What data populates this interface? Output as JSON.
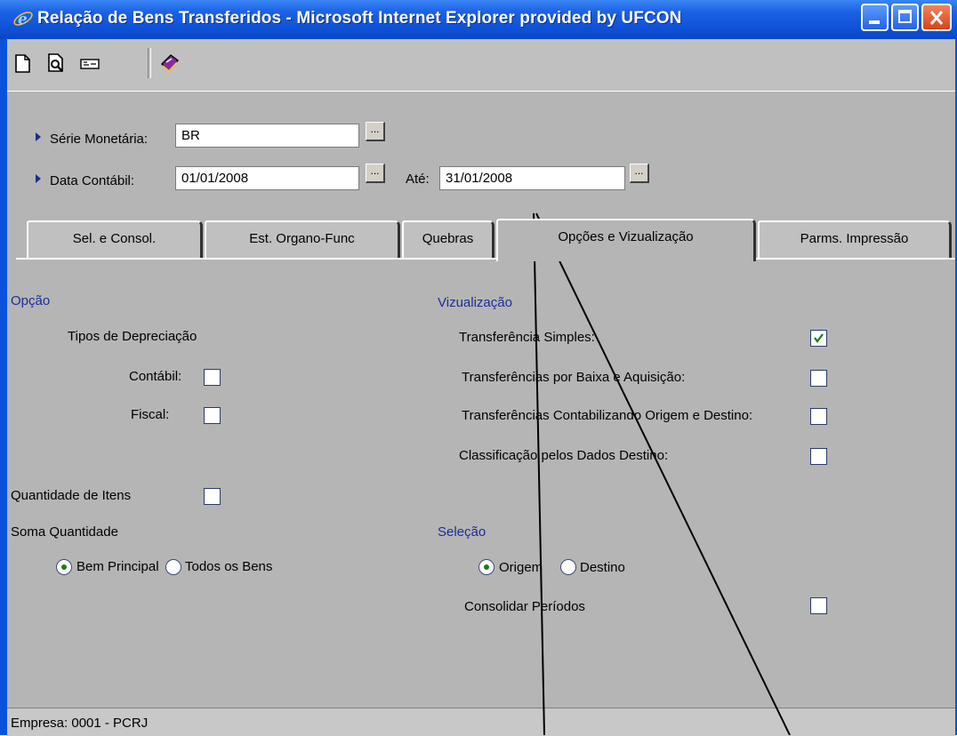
{
  "window": {
    "title": "Relação de Bens Transferidos - Microsoft Internet Explorer provided by UFCON",
    "icon": "ie-icon",
    "controls": [
      "minimize-button",
      "maximize-button",
      "close-button"
    ]
  },
  "toolbar": {
    "icons": [
      "new-document-icon",
      "print-preview-icon",
      "config-icon",
      "help-book-icon"
    ]
  },
  "form": {
    "serie_label": "Série Monetária:",
    "serie_value": "BR",
    "data_label": "Data Contábil:",
    "data_from": "01/01/2008",
    "ate_label": "Até:",
    "data_to": "31/01/2008",
    "ellipsis": "..."
  },
  "tabs": [
    {
      "label": "Sel. e Consol."
    },
    {
      "label": "Est. Organo-Func"
    },
    {
      "label": "Quebras"
    },
    {
      "label": "Opções e Vizualização",
      "active": true
    },
    {
      "label": "Parms. Impressão"
    }
  ],
  "opcao": {
    "title": "Opção",
    "tipos_label": "Tipos de Depreciação",
    "contabil_label": "Contábil:",
    "contabil_checked": false,
    "fiscal_label": "Fiscal:",
    "fiscal_checked": false,
    "quantidade_label": "Quantidade de Itens",
    "quantidade_checked": false,
    "soma_label": "Soma Quantidade",
    "bem_principal_label": "Bem Principal",
    "todos_bens_label": "Todos os Bens",
    "soma_selected": "Bem Principal"
  },
  "vizualizacao": {
    "title": "Vizualização",
    "items": [
      {
        "label": "Transferência Simples:",
        "checked": true
      },
      {
        "label": "Transferências por Baixa e Aquisição:",
        "checked": false
      },
      {
        "label": "Transferências Contabilizando Origem e Destino:",
        "checked": false
      },
      {
        "label": "Classificação pelos Dados Destino:",
        "checked": false
      }
    ]
  },
  "selecao": {
    "title": "Seleção",
    "origem_label": "Origem",
    "destino_label": "Destino",
    "selected": "Origem",
    "consolidar_label": "Consolidar Períodos",
    "consolidar_checked": false
  },
  "status": {
    "text": "Empresa: 0001 - PCRJ"
  },
  "colors": {
    "title_bar": "#0a52dc",
    "section_text": "#1a2e9a",
    "check_mark": "#1a7a1a"
  }
}
